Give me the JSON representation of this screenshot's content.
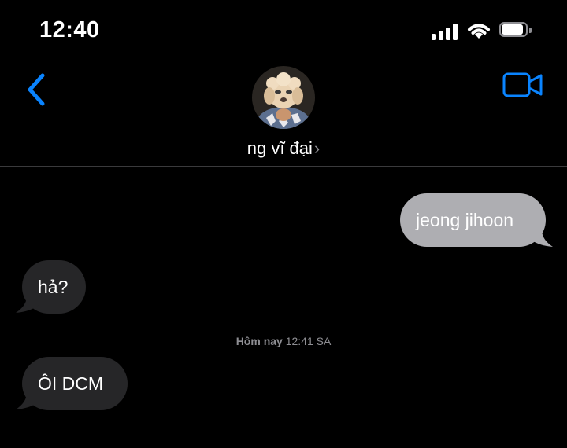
{
  "status_bar": {
    "time": "12:40"
  },
  "header": {
    "contact_name": "ng vĩ đại",
    "chevron": "›"
  },
  "messages": [
    {
      "direction": "outgoing",
      "text": "jeong jihoon"
    },
    {
      "direction": "incoming",
      "text": "hả?"
    },
    {
      "direction": "incoming",
      "text": "ÔI DCM"
    }
  ],
  "timestamp": {
    "day": "Hôm nay",
    "time": "12:41 SA"
  },
  "colors": {
    "accent": "#0a84ff",
    "outgoing_bubble": "#aeaeb2",
    "incoming_bubble": "#262628",
    "background": "#000000"
  }
}
